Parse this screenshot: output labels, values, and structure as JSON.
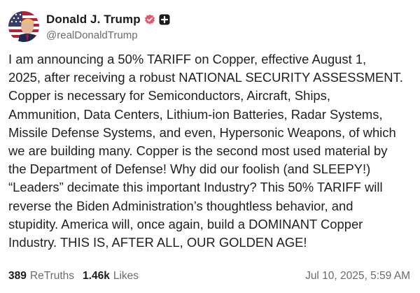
{
  "post": {
    "author": {
      "display_name": "Donald J. Trump",
      "handle": "@realDonaldTrump",
      "verified_icon": "verified-check-icon",
      "verified_color": "#e8556b",
      "extra_badge_icon": "plus-square-icon"
    },
    "body_lines": [
      "I am announcing a 50% TARIFF on Copper, effective August 1,",
      "2025, after receiving a robust NATIONAL SECURITY ASSESSMENT.",
      "Copper is necessary for Semiconductors, Aircraft, Ships,",
      "Ammunition, Data Centers, Lithium-ion Batteries, Radar Systems,",
      "Missile Defense Systems, and even, Hypersonic Weapons, of which",
      "we are building many. Copper is the second most used material by",
      "the Department of Defense! Why did our foolish (and SLEEPY!)",
      "“Leaders” decimate this important Industry? This 50% TARIFF will",
      "reverse the Biden Administration’s thoughtless behavior, and",
      "stupidity. America will, once again, build a DOMINANT Copper",
      "Industry. THIS IS, AFTER ALL, OUR GOLDEN AGE!"
    ],
    "stats": {
      "retruths_count": "389",
      "retruths_label": "ReTruths",
      "likes_count": "1.46k",
      "likes_label": "Likes"
    },
    "timestamp": "Jul 10, 2025, 5:59 AM"
  }
}
